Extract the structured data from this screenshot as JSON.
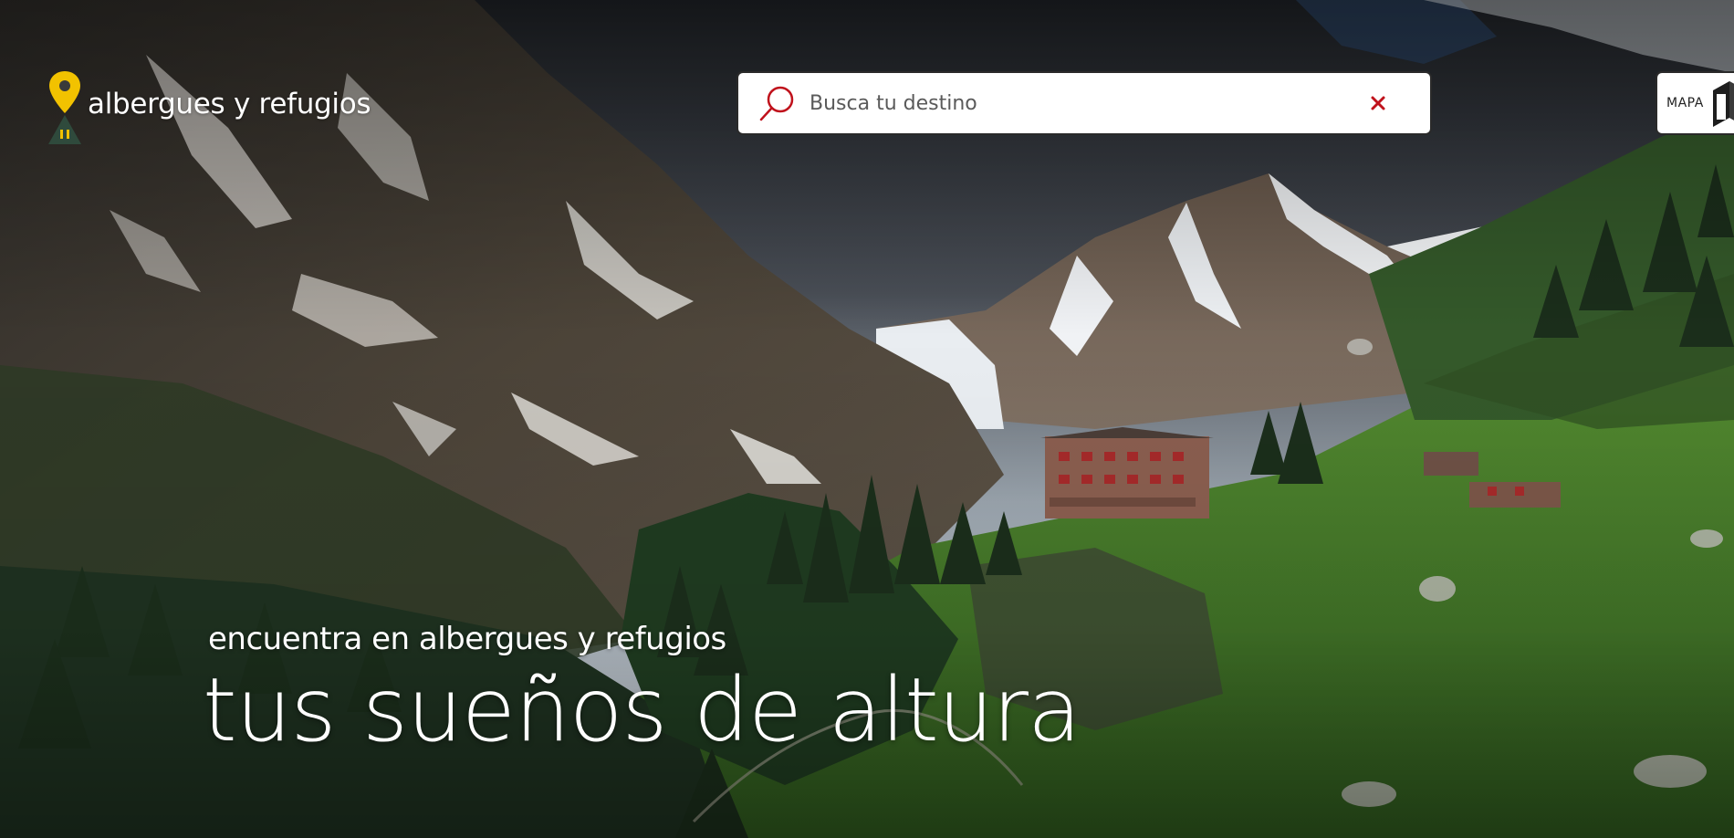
{
  "brand": {
    "name": "albergues y refugios",
    "pin_color": "#f2c200",
    "tent_color": "#2f4a3c"
  },
  "search": {
    "placeholder": "Busca tu destino",
    "value": "",
    "icon": "search-icon",
    "clear_icon": "close-icon",
    "accent_color": "#c0121c"
  },
  "map_button": {
    "label": "MAPA",
    "icon": "map-book-icon"
  },
  "hero": {
    "tagline": "encuentra en albergues y refugios",
    "headline": "tus sueños de altura",
    "image_description_icon": "mountain-landscape"
  }
}
